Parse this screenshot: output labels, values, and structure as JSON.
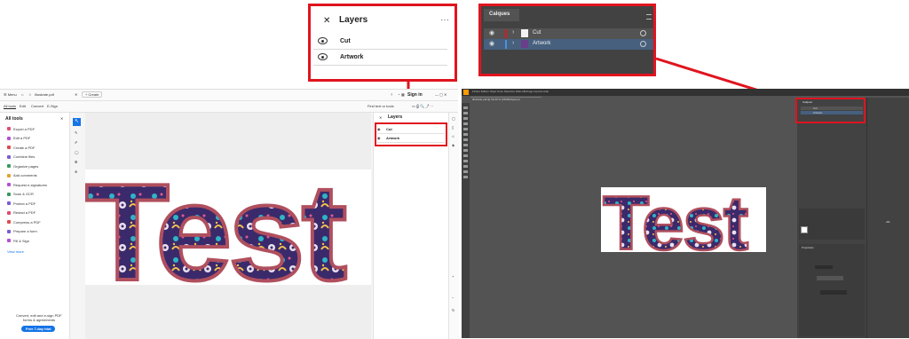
{
  "acrobat": {
    "menu_label": "Menu",
    "file_tab": "Illustrate.pdf",
    "create_label": "+ Create",
    "sign_in": "Sign in",
    "tabs": [
      "All tools",
      "Edit",
      "Convert",
      "E-Sign"
    ],
    "panel_title": "All tools",
    "find_text": "Find text or tools",
    "tools": [
      {
        "label": "Export a PDF",
        "color": "#e04a6d"
      },
      {
        "label": "Edit a PDF",
        "color": "#b44fd3"
      },
      {
        "label": "Create a PDF",
        "color": "#e04a4a"
      },
      {
        "label": "Combine files",
        "color": "#7a5cd6"
      },
      {
        "label": "Organize pages",
        "color": "#3a9a5b"
      },
      {
        "label": "Add comments",
        "color": "#e0a52a"
      },
      {
        "label": "Request e-signatures",
        "color": "#b44fd3"
      },
      {
        "label": "Scan & OCR",
        "color": "#3a9a5b"
      },
      {
        "label": "Protect a PDF",
        "color": "#7a5cd6"
      },
      {
        "label": "Redact a PDF",
        "color": "#e04a6d"
      },
      {
        "label": "Compress a PDF",
        "color": "#e04a4a"
      },
      {
        "label": "Prepare a form",
        "color": "#7a5cd6"
      },
      {
        "label": "Fill & Sign",
        "color": "#b44fd3"
      }
    ],
    "view_more": "View more",
    "promo_line1": "Convert, edit and e-sign PDF",
    "promo_line2": "forms & agreements",
    "promo_button": "Free 7-day trial",
    "layers_panel_title": "Layers",
    "layers": [
      "Cut",
      "Artwork"
    ],
    "artwork_text": "Test"
  },
  "zoom_acrobat": {
    "title": "Layers",
    "more": "···",
    "layers": [
      "Cut",
      "Artwork"
    ]
  },
  "zoom_illustrator": {
    "title": "Calques",
    "layers": [
      "Cut",
      "Artwork"
    ],
    "colors": {
      "cut": "#e0141e",
      "artwork": "#4a90e2"
    }
  },
  "illustrator": {
    "file_tab": "Illustrate.pdf @ 33,33 % (CMJN/Aperçu)",
    "panel_title": "Calques",
    "layers": [
      "Cut",
      "Artwork"
    ],
    "properties_title": "Propriétés",
    "artwork_text": "Test"
  },
  "colors": {
    "callout": "#e0141e",
    "acrobat_accent": "#1473e6"
  }
}
